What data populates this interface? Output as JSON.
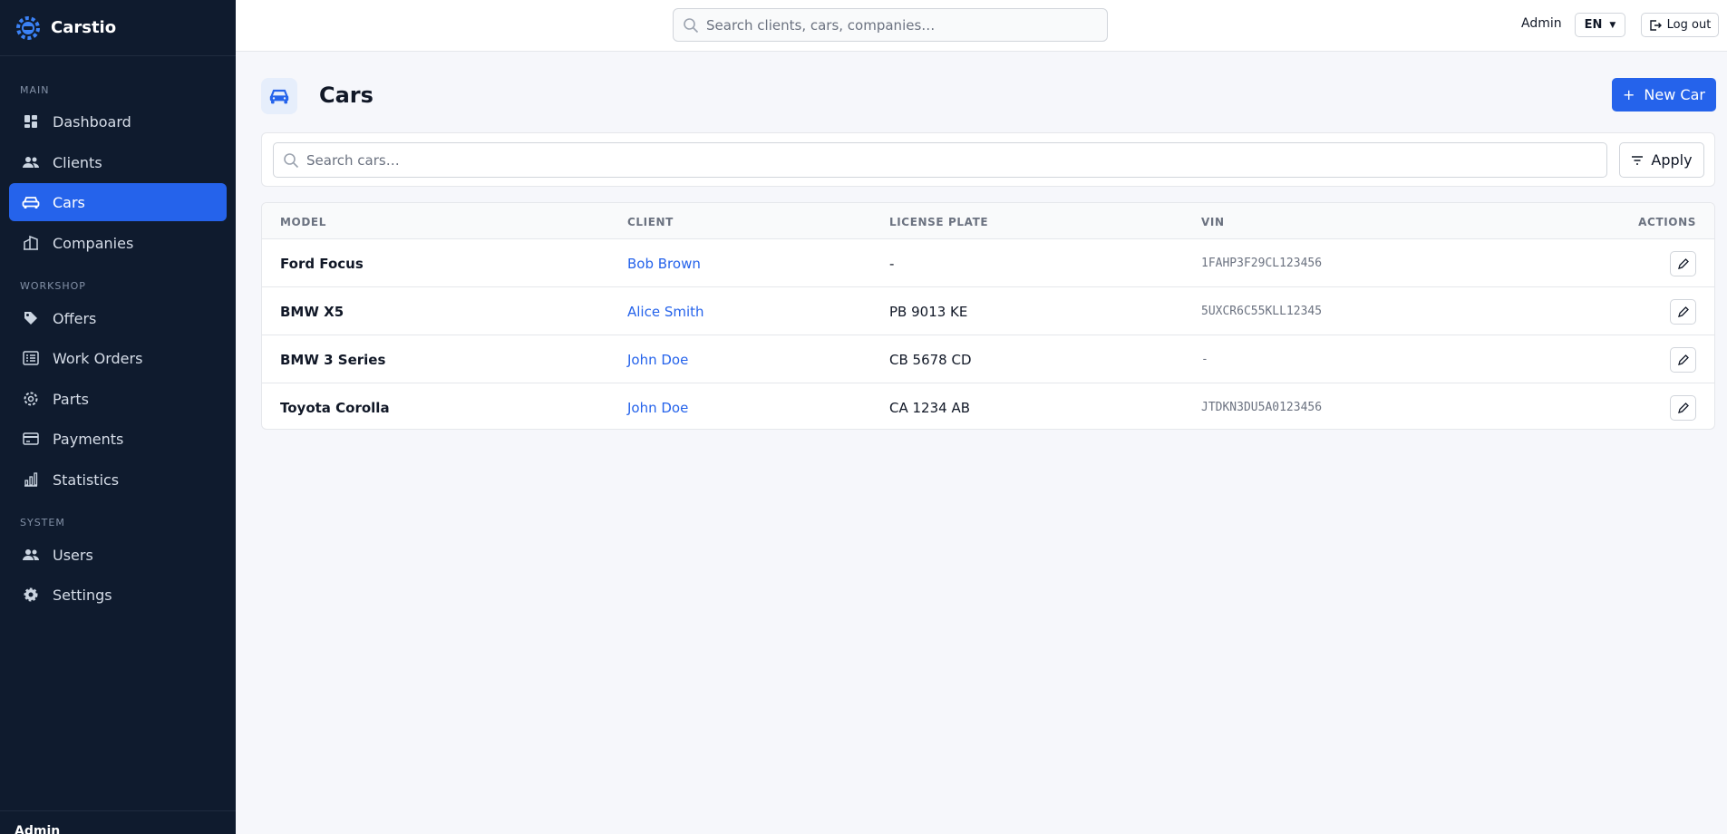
{
  "app": {
    "name": "Carstio"
  },
  "topbar": {
    "search_placeholder": "Search clients, cars, companies…",
    "user_label": "Admin",
    "language": "EN",
    "logout_label": "Log out"
  },
  "sidebar": {
    "sections": [
      {
        "label": "MAIN"
      },
      {
        "label": "WORKSHOP"
      },
      {
        "label": "SYSTEM"
      }
    ],
    "items": [
      {
        "label": "Dashboard",
        "icon": "grid-icon"
      },
      {
        "label": "Clients",
        "icon": "people-icon"
      },
      {
        "label": "Cars",
        "icon": "car-icon",
        "active": true
      },
      {
        "label": "Companies",
        "icon": "buildings-icon"
      },
      {
        "label": "Offers",
        "icon": "tag-icon"
      },
      {
        "label": "Work Orders",
        "icon": "list-icon"
      },
      {
        "label": "Parts",
        "icon": "gear-icon"
      },
      {
        "label": "Payments",
        "icon": "credit-card-icon"
      },
      {
        "label": "Statistics",
        "icon": "bar-chart-icon"
      },
      {
        "label": "Users",
        "icon": "people-icon"
      },
      {
        "label": "Settings",
        "icon": "cog-icon"
      }
    ],
    "footer_user": "Admin"
  },
  "page": {
    "title": "Cars",
    "new_button": "New Car",
    "search_placeholder": "Search cars…",
    "apply_label": "Apply"
  },
  "table": {
    "columns": [
      "MODEL",
      "CLIENT",
      "LICENSE PLATE",
      "VIN",
      "ACTIONS"
    ],
    "rows": [
      {
        "model": "Ford Focus",
        "client": "Bob Brown",
        "plate": "-",
        "vin": "1FAHP3F29CL123456"
      },
      {
        "model": "BMW X5",
        "client": "Alice Smith",
        "plate": "PB 9013 KE",
        "vin": "5UXCR6C55KLL12345"
      },
      {
        "model": "BMW 3 Series",
        "client": "John Doe",
        "plate": "CB 5678 CD",
        "vin": "-"
      },
      {
        "model": "Toyota Corolla",
        "client": "John Doe",
        "plate": "CA 1234 AB",
        "vin": "JTDKN3DU5A0123456"
      }
    ]
  },
  "colors": {
    "sidebar_bg": "#0f1b2e",
    "accent": "#2563eb",
    "page_bg": "#f6f7fb"
  }
}
